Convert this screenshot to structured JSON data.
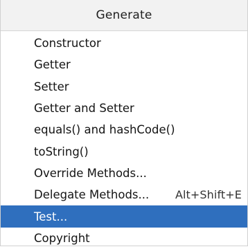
{
  "popup": {
    "title": "Generate",
    "items": [
      {
        "label": "Constructor",
        "shortcut": ""
      },
      {
        "label": "Getter",
        "shortcut": ""
      },
      {
        "label": "Setter",
        "shortcut": ""
      },
      {
        "label": "Getter and Setter",
        "shortcut": ""
      },
      {
        "label": "equals() and hashCode()",
        "shortcut": ""
      },
      {
        "label": "toString()",
        "shortcut": ""
      },
      {
        "label": "Override Methods...",
        "shortcut": ""
      },
      {
        "label": "Delegate Methods...",
        "shortcut": "Alt+Shift+E"
      },
      {
        "label": "Test...",
        "shortcut": ""
      },
      {
        "label": "Copyright",
        "shortcut": ""
      }
    ],
    "selected_index": 8
  },
  "colors": {
    "selection_background": "#2f6fbe",
    "header_background": "#f2f2f2"
  }
}
